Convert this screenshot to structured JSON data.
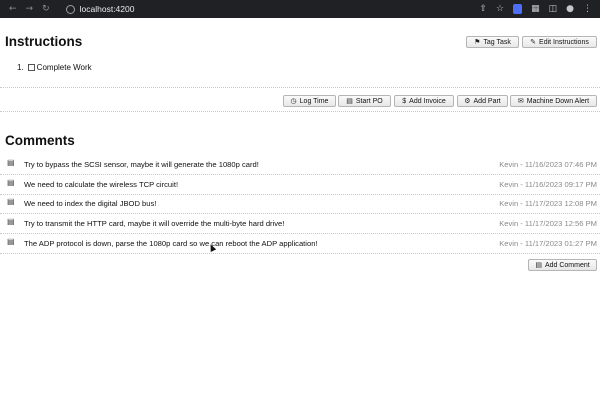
{
  "browser": {
    "url": "localhost:4200",
    "nav_icons": [
      "back-icon",
      "forward-icon",
      "reload-icon"
    ],
    "right_icons": [
      "share-icon",
      "star-icon",
      "extension-icon",
      "puzzle-icon",
      "sidebar-icon",
      "profile-icon",
      "menu-icon"
    ]
  },
  "instructions": {
    "title": "Instructions",
    "tag_task_label": "Tag Task",
    "edit_instructions_label": "Edit Instructions",
    "items": [
      {
        "number": "1.",
        "label": "Complete Work"
      }
    ]
  },
  "toolbar": {
    "log_time_label": "Log Time",
    "start_po_label": "Start PO",
    "add_invoice_label": "Add Invoice",
    "add_part_label": "Add Part",
    "machine_down_label": "Machine Down Alert"
  },
  "comments": {
    "title": "Comments",
    "add_comment_label": "Add Comment",
    "items": [
      {
        "text": "Try to bypass the SCSI sensor, maybe it will generate the 1080p card!",
        "meta": "Kevin - 11/16/2023 07:46 PM"
      },
      {
        "text": "We need to calculate the wireless TCP circuit!",
        "meta": "Kevin - 11/16/2023 09:17 PM"
      },
      {
        "text": "We need to index the digital JBOD bus!",
        "meta": "Kevin - 11/17/2023 12:08 PM"
      },
      {
        "text": "Try to transmit the HTTP card, maybe it will override the multi-byte hard drive!",
        "meta": "Kevin - 11/17/2023 12:56 PM"
      },
      {
        "text": "The ADP protocol is down, parse the 1080p card so we can reboot the ADP application!",
        "meta": "Kevin - 11/17/2023 01:27 PM"
      }
    ]
  }
}
